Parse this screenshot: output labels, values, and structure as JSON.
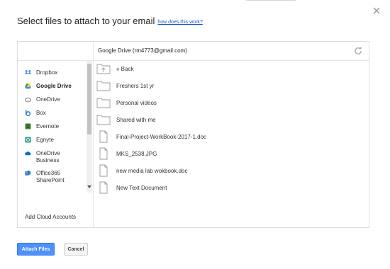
{
  "dialog": {
    "title": "Select files to attach to your email",
    "help_link": "how does this work?",
    "account": "Google Drive (rm4773@gmail.com)"
  },
  "sidebar": {
    "items": [
      {
        "label": "Dropbox",
        "icon": "dropbox-icon",
        "active": false
      },
      {
        "label": "Google Drive",
        "icon": "google-drive-icon",
        "active": true
      },
      {
        "label": "OneDrive",
        "icon": "onedrive-icon",
        "active": false
      },
      {
        "label": "Box",
        "icon": "box-icon",
        "active": false
      },
      {
        "label": "Evernote",
        "icon": "evernote-icon",
        "active": false
      },
      {
        "label": "Egnyte",
        "icon": "egnyte-icon",
        "active": false
      },
      {
        "label": "OneDrive\nBusiness",
        "icon": "onedrive-business-icon",
        "active": false
      },
      {
        "label": "Office365\nSharePoint",
        "icon": "sharepoint-icon",
        "active": false
      }
    ],
    "add_cloud": "Add Cloud Accounts"
  },
  "files": [
    {
      "name": "« Back",
      "icon": "back-folder-icon"
    },
    {
      "name": "Freshers 1st yr",
      "icon": "folder-icon"
    },
    {
      "name": "Personal videos",
      "icon": "folder-icon"
    },
    {
      "name": "Shared with me",
      "icon": "folder-icon"
    },
    {
      "name": "Final-Project-WorkBook-2017-1.doc",
      "icon": "document-icon"
    },
    {
      "name": "MKS_2538.JPG",
      "icon": "document-icon"
    },
    {
      "name": "new media lab wokbook.doc",
      "icon": "document-icon"
    },
    {
      "name": "New Text Document",
      "icon": "document-icon"
    }
  ],
  "buttons": {
    "attach": "Attach Files",
    "cancel": "Cancel"
  },
  "colors": {
    "primary": "#4d90fe",
    "link": "#1155cc",
    "dropbox": "#2b8ae8",
    "box": "#1f6fd1",
    "evernote": "#4caf50",
    "onedrive": "#0a6cd6",
    "sharepoint": "#1f5fb0"
  }
}
